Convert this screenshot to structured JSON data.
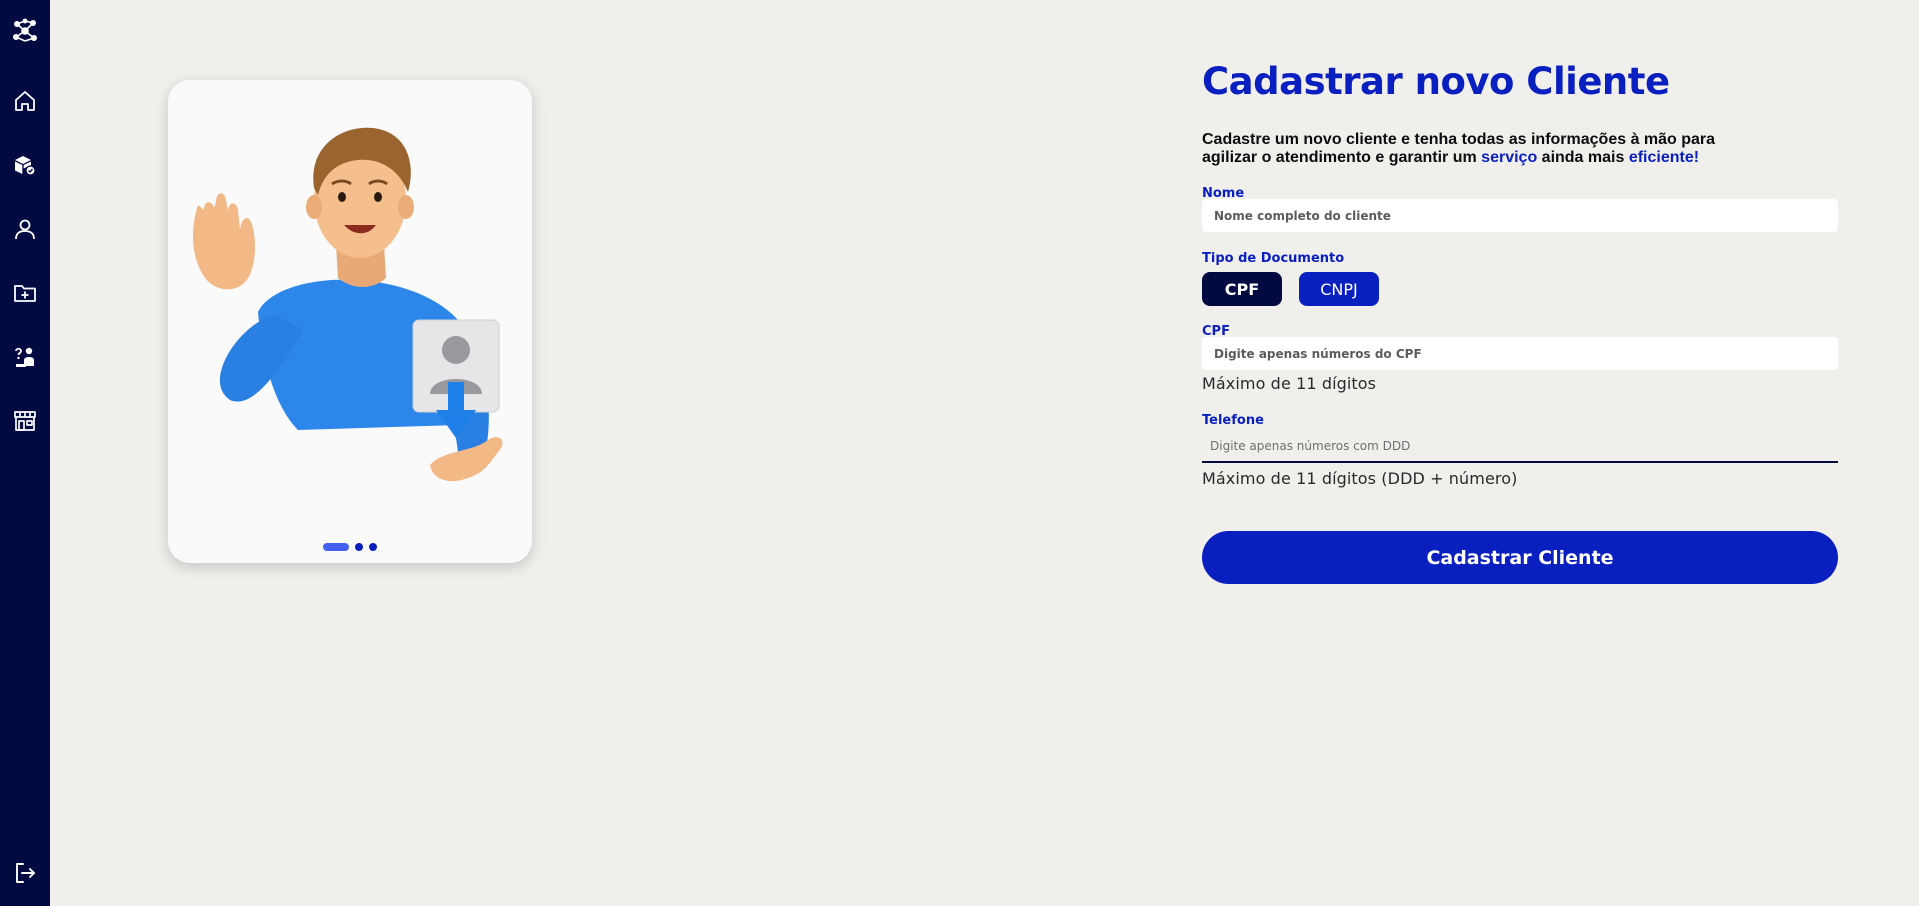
{
  "sidebar": {
    "items": [
      {
        "icon": "network-logo-icon"
      },
      {
        "icon": "home-icon"
      },
      {
        "icon": "products-icon"
      },
      {
        "icon": "user-icon"
      },
      {
        "icon": "folder-add-icon"
      },
      {
        "icon": "support-icon"
      },
      {
        "icon": "store-icon"
      },
      {
        "icon": "logout-icon"
      }
    ]
  },
  "colors": {
    "primary": "#0a1fc0",
    "sidebar": "#030a42",
    "background": "#f0efec"
  },
  "carousel": {
    "slide_count": 3,
    "active_index": 0
  },
  "form": {
    "title": "Cadastrar novo Cliente",
    "description_part1": "Cadastre um novo cliente e tenha todas as informações à mão para agilizar o atendimento e garantir um ",
    "description_highlight1": "serviço",
    "description_part2": " ainda mais ",
    "description_highlight2": "eficiente!",
    "name_label": "Nome",
    "name_placeholder": "Nome completo do cliente",
    "doc_type_label": "Tipo de Documento",
    "doc_cpf": "CPF",
    "doc_cnpj": "CNPJ",
    "doc_selected": "CPF",
    "cpf_label": "CPF",
    "cpf_placeholder": "Digite apenas números do CPF",
    "cpf_hint": "Máximo de 11 dígitos",
    "phone_label": "Telefone",
    "phone_placeholder": "Digite apenas números com DDD",
    "phone_hint": "Máximo de 11 dígitos (DDD + número)",
    "submit_label": "Cadastrar Cliente"
  }
}
